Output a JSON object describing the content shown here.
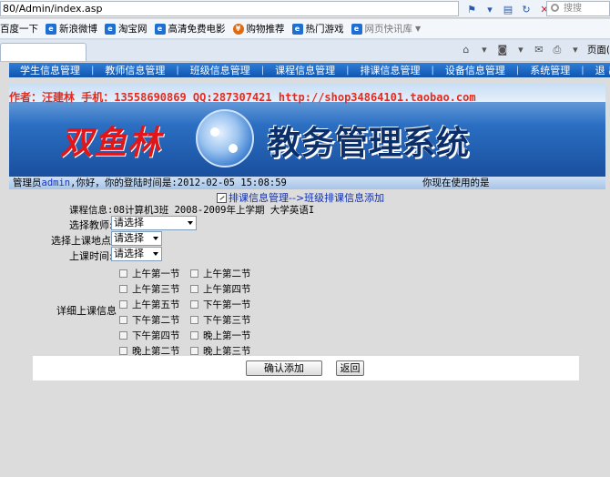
{
  "browser": {
    "address": "80/Admin/index.asp",
    "search_placeholder": "搜搜",
    "favorites": [
      {
        "label": "百度一下",
        "icon": "ie-icon"
      },
      {
        "label": "新浪微博",
        "icon": "ie-icon"
      },
      {
        "label": "淘宝网",
        "icon": "ie-icon"
      },
      {
        "label": "高清免费电影",
        "icon": "ie-icon"
      },
      {
        "label": "购物推荐",
        "icon": "shopping-icon"
      },
      {
        "label": "热门游戏",
        "icon": "ie-icon"
      },
      {
        "label": "网页快讯库",
        "icon": "ie-icon"
      }
    ],
    "page_menu_label": "页面("
  },
  "nav": {
    "items": [
      "学生信息管理",
      "教师信息管理",
      "班级信息管理",
      "课程信息管理",
      "排课信息管理",
      "设备信息管理",
      "系统管理",
      "退 出"
    ]
  },
  "banner": {
    "credit": "作者：汪建林  手机：13558690869 QQ:287307421 http://shop34864101.taobao.com",
    "logo": "双鱼林",
    "title": "教务管理系统"
  },
  "status": {
    "prefix": "管理员",
    "admin": "admin",
    "suffix": ",你好，你的登陆时间是:2012-02-05 15:08:59",
    "right": "你现在使用的是"
  },
  "form": {
    "breadcrumb": "排课信息管理-->班级排课信息添加",
    "course_info": "课程信息:08计算机3班 2008-2009年上学期 大学英语I",
    "teacher_label": "选择教师:",
    "teacher_value": "请选择",
    "room_label": "选择上课地点:",
    "room_value": "请选择",
    "time_label": "上课时间:",
    "time_value": "请选择",
    "detail_label": "详细上课信息",
    "periods": [
      [
        "上午第一节",
        "上午第二节"
      ],
      [
        "上午第三节",
        "上午第四节"
      ],
      [
        "上午第五节",
        "下午第一节"
      ],
      [
        "下午第二节",
        "下午第三节"
      ],
      [
        "下午第四节",
        "晚上第一节"
      ],
      [
        "晚上第二节",
        "晚上第三节"
      ]
    ],
    "submit_label": "确认添加",
    "back_label": "返回"
  }
}
